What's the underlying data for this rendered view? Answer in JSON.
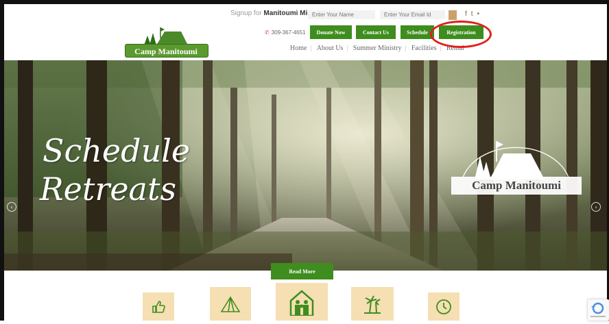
{
  "signup": {
    "prefix": "Signup for ",
    "brand": "Manitoumi Minute",
    "name_placeholder": "Enter Your Name",
    "email_placeholder": "Enter Your Email Id",
    "icons": [
      "facebook-icon",
      "twitter-icon",
      "rss-icon"
    ]
  },
  "header": {
    "logo_name": "Camp Manitoumi",
    "phone": "309-367-4651",
    "buttons": {
      "donate": "Donate Now",
      "contact": "Contact Us",
      "schedule": "Schedule",
      "registration": "Registration"
    },
    "nav": [
      "Home",
      "About Us",
      "Summer Ministry",
      "Facilities",
      "Rental"
    ]
  },
  "hero": {
    "line1": "Schedule",
    "line2": "Retreats",
    "logo_name": "Camp Manitoumi",
    "read_more": "Read More"
  },
  "features": [
    "thumbs-up-icon",
    "tent-icon",
    "family-home-icon",
    "palm-island-icon",
    "clock-icon"
  ],
  "colors": {
    "brand_green": "#3e8d1e",
    "feature_tan": "#f5dfb3",
    "annotation_red": "#e0201a"
  }
}
